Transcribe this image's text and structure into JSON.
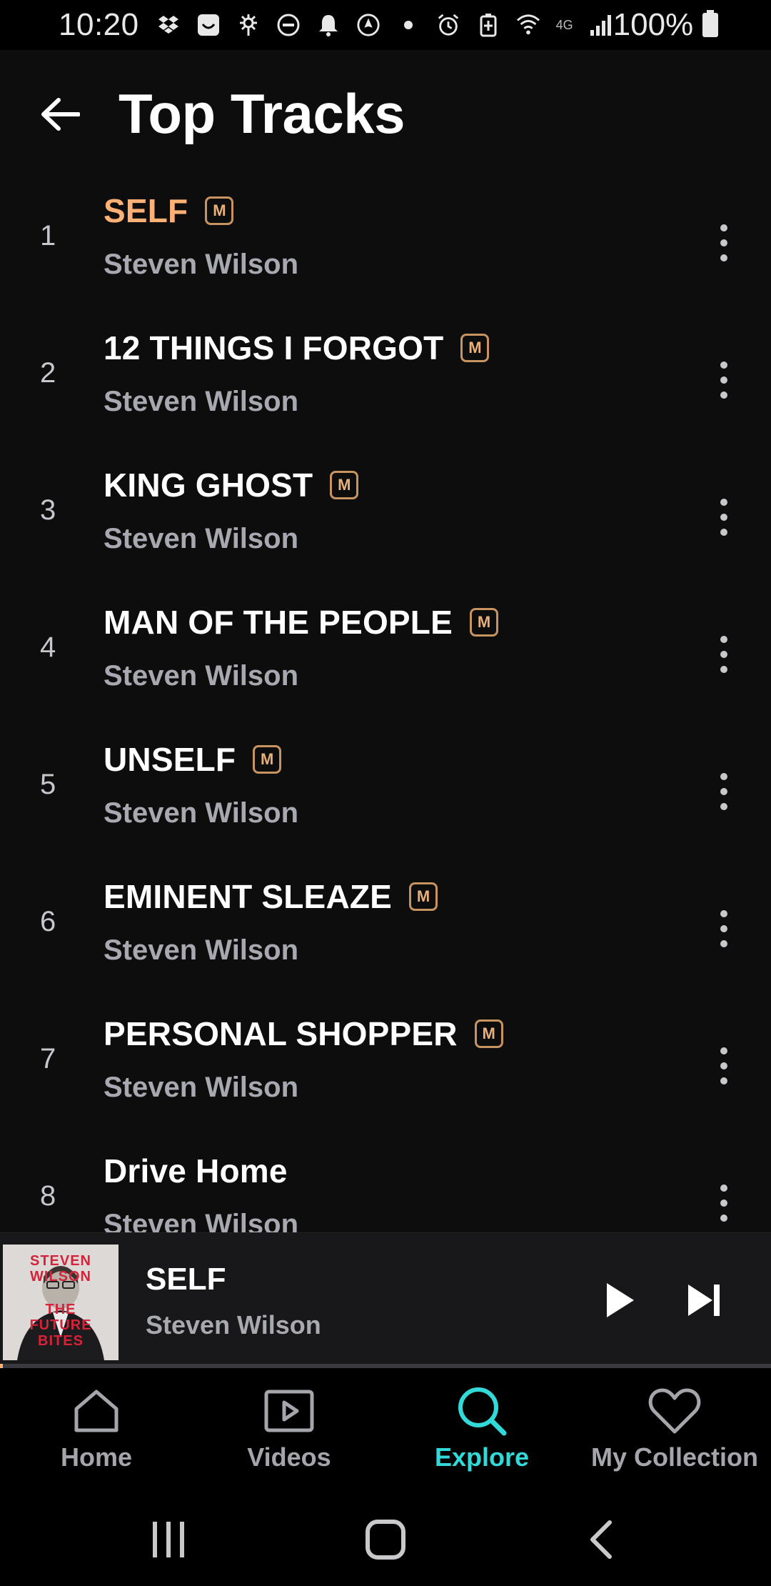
{
  "status_bar": {
    "time": "10:20",
    "network": "4G",
    "battery": "100%"
  },
  "header": {
    "title": "Top Tracks"
  },
  "tracks": [
    {
      "number": "1",
      "title": "SELF",
      "artist": "Steven Wilson",
      "badge": "M",
      "active": true
    },
    {
      "number": "2",
      "title": "12 THINGS I FORGOT",
      "artist": "Steven Wilson",
      "badge": "M",
      "active": false
    },
    {
      "number": "3",
      "title": "KING GHOST",
      "artist": "Steven Wilson",
      "badge": "M",
      "active": false
    },
    {
      "number": "4",
      "title": "MAN OF THE PEOPLE",
      "artist": "Steven Wilson",
      "badge": "M",
      "active": false
    },
    {
      "number": "5",
      "title": "UNSELF",
      "artist": "Steven Wilson",
      "badge": "M",
      "active": false
    },
    {
      "number": "6",
      "title": "EMINENT SLEAZE",
      "artist": "Steven Wilson",
      "badge": "M",
      "active": false
    },
    {
      "number": "7",
      "title": "PERSONAL SHOPPER",
      "artist": "Steven Wilson",
      "badge": "M",
      "active": false
    },
    {
      "number": "8",
      "title": "Drive Home",
      "artist": "Steven Wilson",
      "badge": "",
      "active": false
    }
  ],
  "now_playing": {
    "title": "SELF",
    "artist": "Steven Wilson",
    "album_art_text": [
      "STEVEN",
      "WILSON",
      "THE",
      "FUTURE",
      "BITES"
    ],
    "progress": 0.004
  },
  "bottom_nav": {
    "items": [
      {
        "label": "Home",
        "icon": "home-icon",
        "active": false
      },
      {
        "label": "Videos",
        "icon": "video-icon",
        "active": false
      },
      {
        "label": "Explore",
        "icon": "search-icon",
        "active": true
      },
      {
        "label": "My Collection",
        "icon": "heart-icon",
        "active": false
      }
    ]
  },
  "colors": {
    "accent": "#ffb074",
    "explore_active": "#33d8d8",
    "badge": "#c7935e",
    "background": "#0d0d0e"
  }
}
